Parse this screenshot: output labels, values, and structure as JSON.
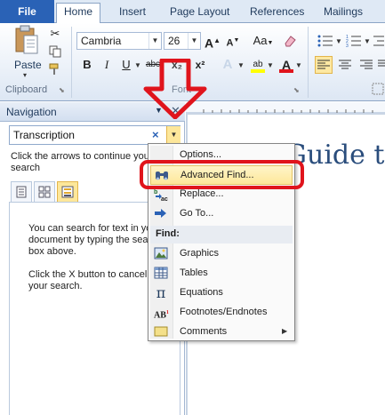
{
  "ribbon_tabs": {
    "file": "File",
    "home": "Home",
    "insert": "Insert",
    "page_layout": "Page Layout",
    "references": "References",
    "mailings": "Mailings"
  },
  "clipboard": {
    "paste": "Paste",
    "group_label": "Clipboard"
  },
  "font": {
    "family": "Cambria",
    "size": "26",
    "group_label": "Font",
    "bold": "B",
    "italic": "I",
    "underline": "U",
    "strike": "abc",
    "subscript": "x₂",
    "superscript": "x²",
    "grow": "A",
    "shrink": "A",
    "change_case": "Aa",
    "text_effects": "A",
    "font_color": "A",
    "highlight": "ab"
  },
  "navigation": {
    "title": "Navigation",
    "search_value": "Transcription",
    "hint": "Click the arrows to continue your search",
    "message1": "You can search for text in your document by typing the search box above.",
    "message2": "Click the X button to cancel your search."
  },
  "document": {
    "heading": "Quick Guide to"
  },
  "menu": {
    "options": "Options...",
    "advanced_find": "Advanced Find...",
    "replace": "Replace...",
    "go_to": "Go To...",
    "find_header": "Find:",
    "graphics": "Graphics",
    "tables": "Tables",
    "equations": "Equations",
    "footnotes": "Footnotes/Endnotes",
    "comments": "Comments"
  },
  "colors": {
    "file_tab": "#2a62b6",
    "annotation_red": "#e0141c",
    "highlight": "#fde79a",
    "heading_blue": "#2a4d7c"
  }
}
